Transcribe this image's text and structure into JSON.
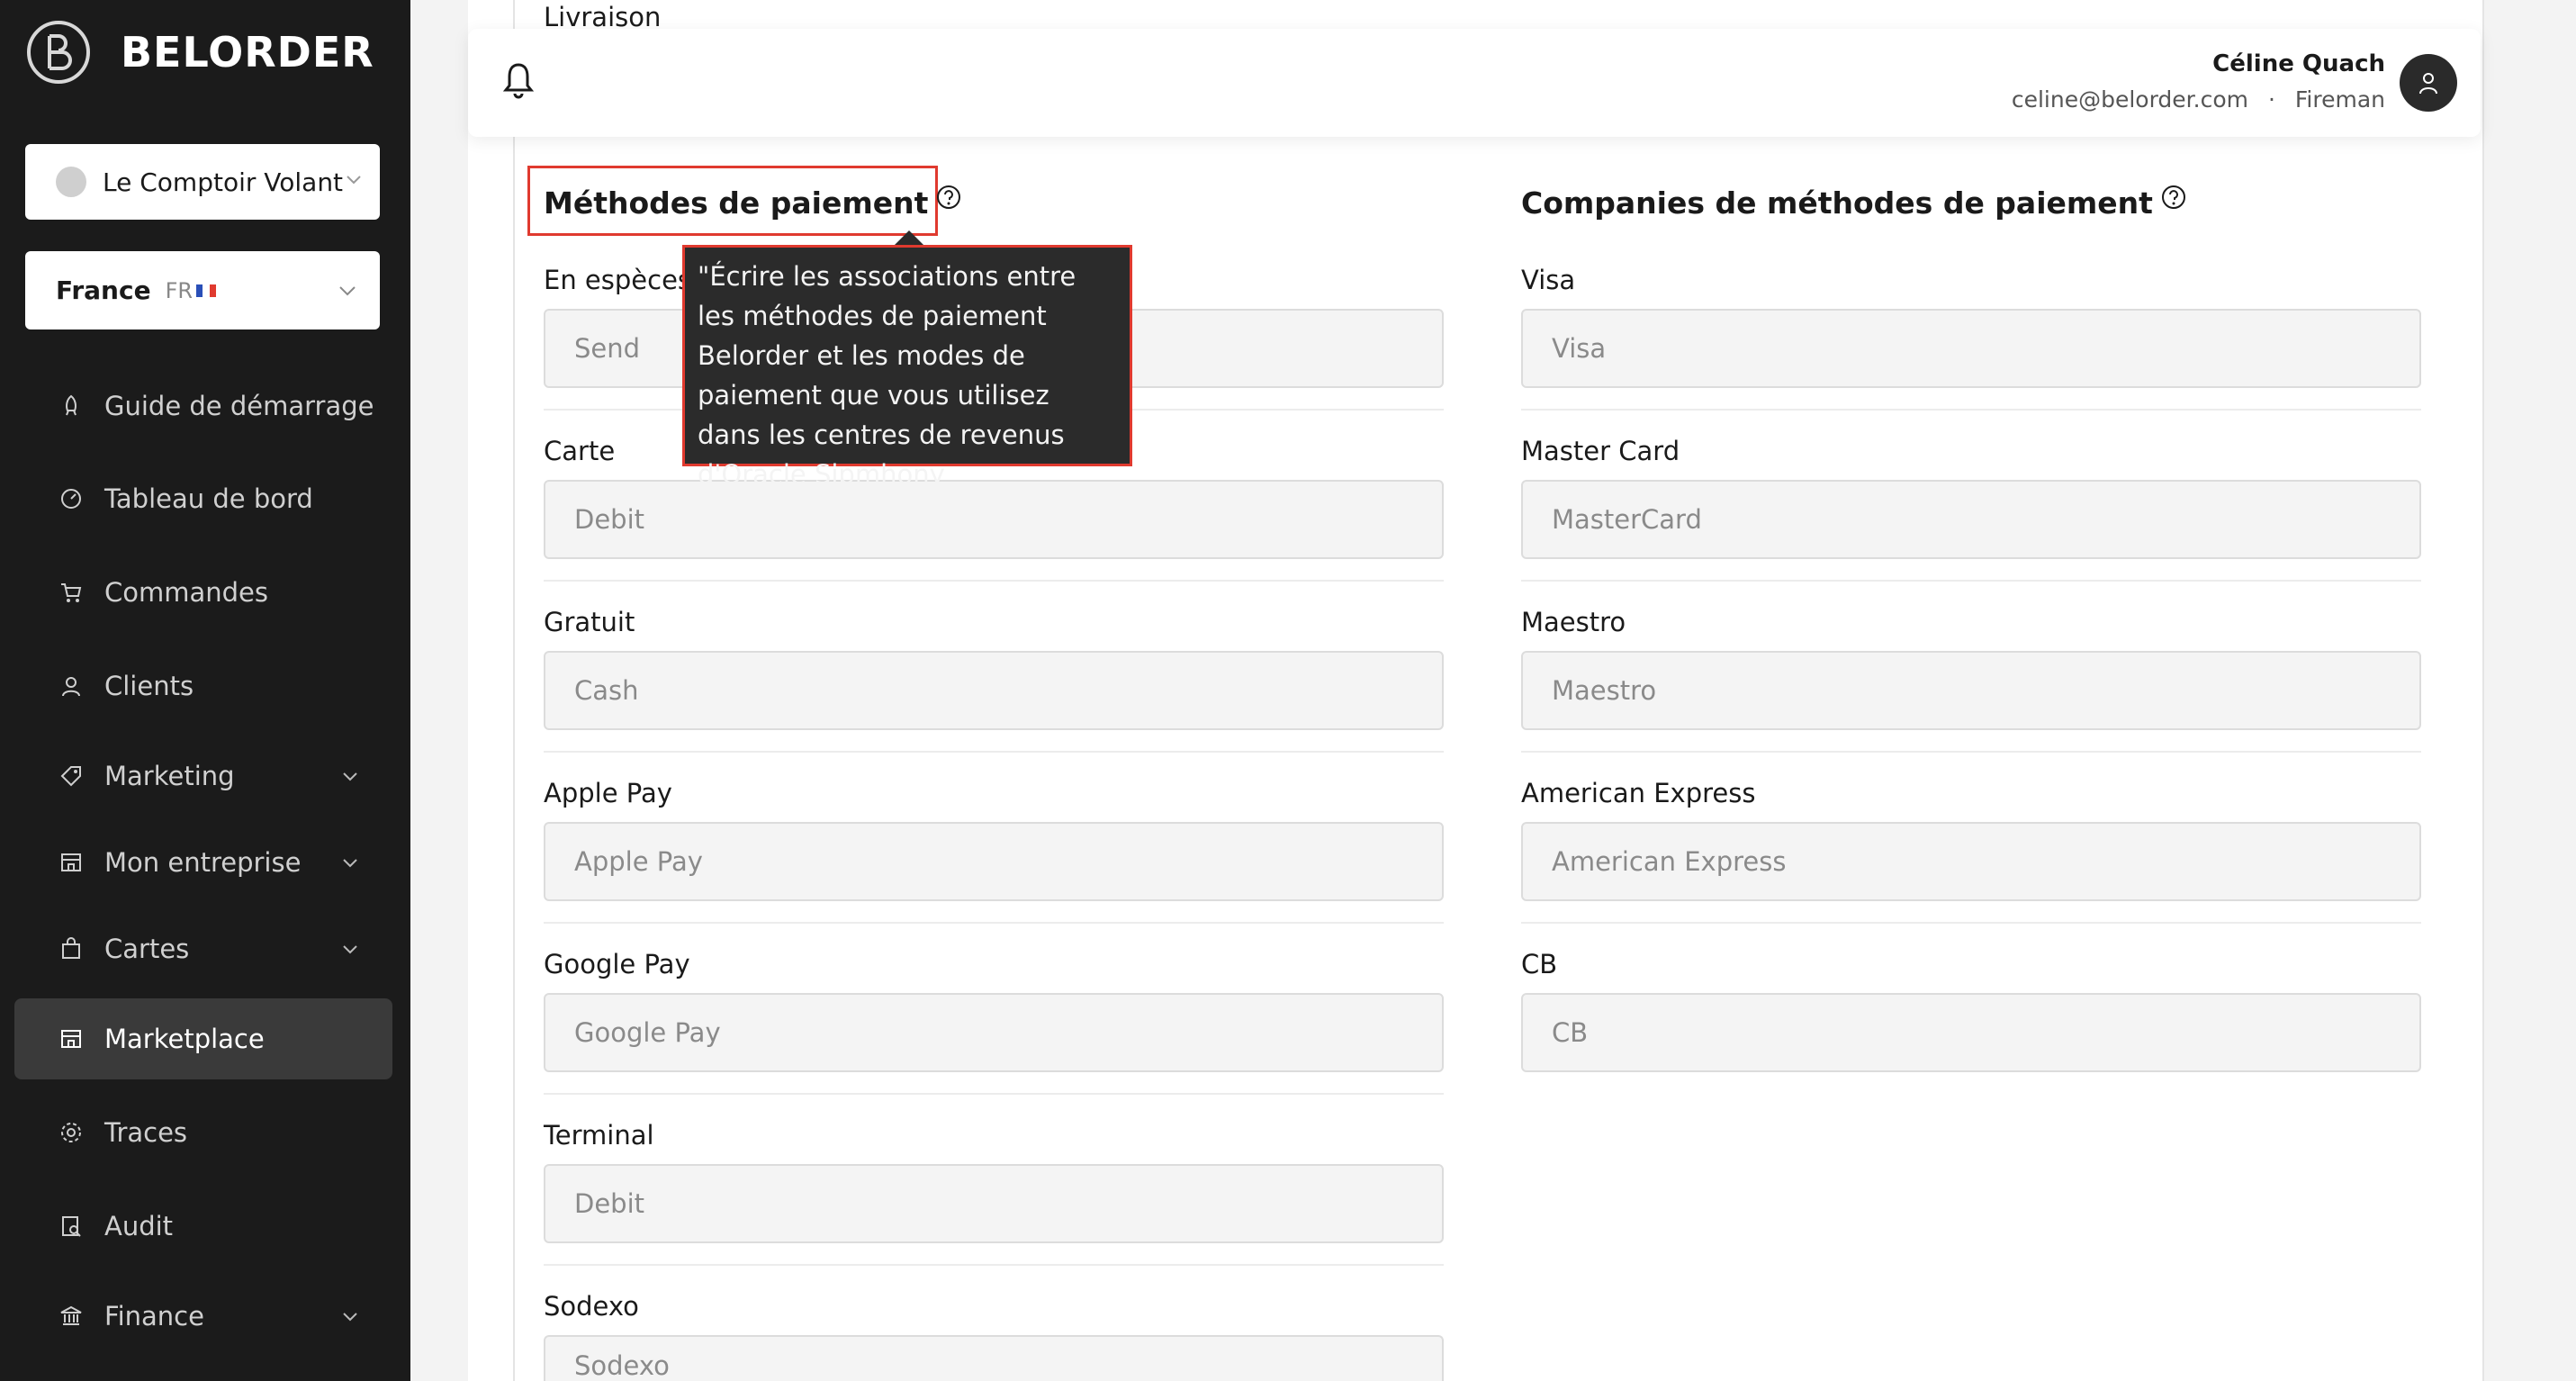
{
  "brand": {
    "name": "BELORDER"
  },
  "store_selector": {
    "value": "Le Comptoir Volant"
  },
  "country_selector": {
    "value": "France",
    "code": "FR"
  },
  "nav": [
    {
      "label": "Guide de démarrage",
      "icon": "rocket-icon",
      "expandable": false,
      "active": false
    },
    {
      "label": "Tableau de bord",
      "icon": "gauge-icon",
      "expandable": false,
      "active": false
    },
    {
      "label": "Commandes",
      "icon": "cart-icon",
      "expandable": false,
      "active": false
    },
    {
      "label": "Clients",
      "icon": "user-icon",
      "expandable": false,
      "active": false
    },
    {
      "label": "Marketing",
      "icon": "tag-icon",
      "expandable": true,
      "active": false
    },
    {
      "label": "Mon entreprise",
      "icon": "store-icon",
      "expandable": true,
      "active": false
    },
    {
      "label": "Cartes",
      "icon": "bag-icon",
      "expandable": true,
      "active": false
    },
    {
      "label": "Marketplace",
      "icon": "marketplace-icon",
      "expandable": false,
      "active": true
    },
    {
      "label": "Traces",
      "icon": "gear-icon",
      "expandable": false,
      "active": false
    },
    {
      "label": "Audit",
      "icon": "audit-icon",
      "expandable": false,
      "active": false
    },
    {
      "label": "Finance",
      "icon": "bank-icon",
      "expandable": true,
      "active": false
    }
  ],
  "header": {
    "user_name": "Céline Quach",
    "user_email": "celine@belorder.com",
    "separator": "·",
    "user_role": "Fireman"
  },
  "page": {
    "previous_section": "Livraison",
    "payment_methods": {
      "title": "Méthodes de paiement",
      "tooltip": "\"Écrire les associations entre les méthodes de paiement Belorder et les modes de paiement que vous utilisez dans les centres de revenus d'Oracle Sipmhony",
      "fields": [
        {
          "label": "En espèces",
          "value": "Send"
        },
        {
          "label": "Carte",
          "value": "Debit"
        },
        {
          "label": "Gratuit",
          "value": "Cash"
        },
        {
          "label": "Apple Pay",
          "value": "Apple Pay"
        },
        {
          "label": "Google Pay",
          "value": "Google Pay"
        },
        {
          "label": "Terminal",
          "value": "Debit"
        },
        {
          "label": "Sodexo",
          "value": "Sodexo"
        }
      ]
    },
    "payment_companies": {
      "title": "Companies de méthodes de paiement",
      "fields": [
        {
          "label": "Visa",
          "value": "Visa"
        },
        {
          "label": "Master Card",
          "value": "MasterCard"
        },
        {
          "label": "Maestro",
          "value": "Maestro"
        },
        {
          "label": "American Express",
          "value": "American Express"
        },
        {
          "label": "CB",
          "value": "CB"
        }
      ]
    }
  },
  "colors": {
    "sidebar_bg": "#1b1b1b",
    "active_nav": "#3a3a3a",
    "highlight": "#e03a2f",
    "tooltip_bg": "#2b2b2b"
  }
}
